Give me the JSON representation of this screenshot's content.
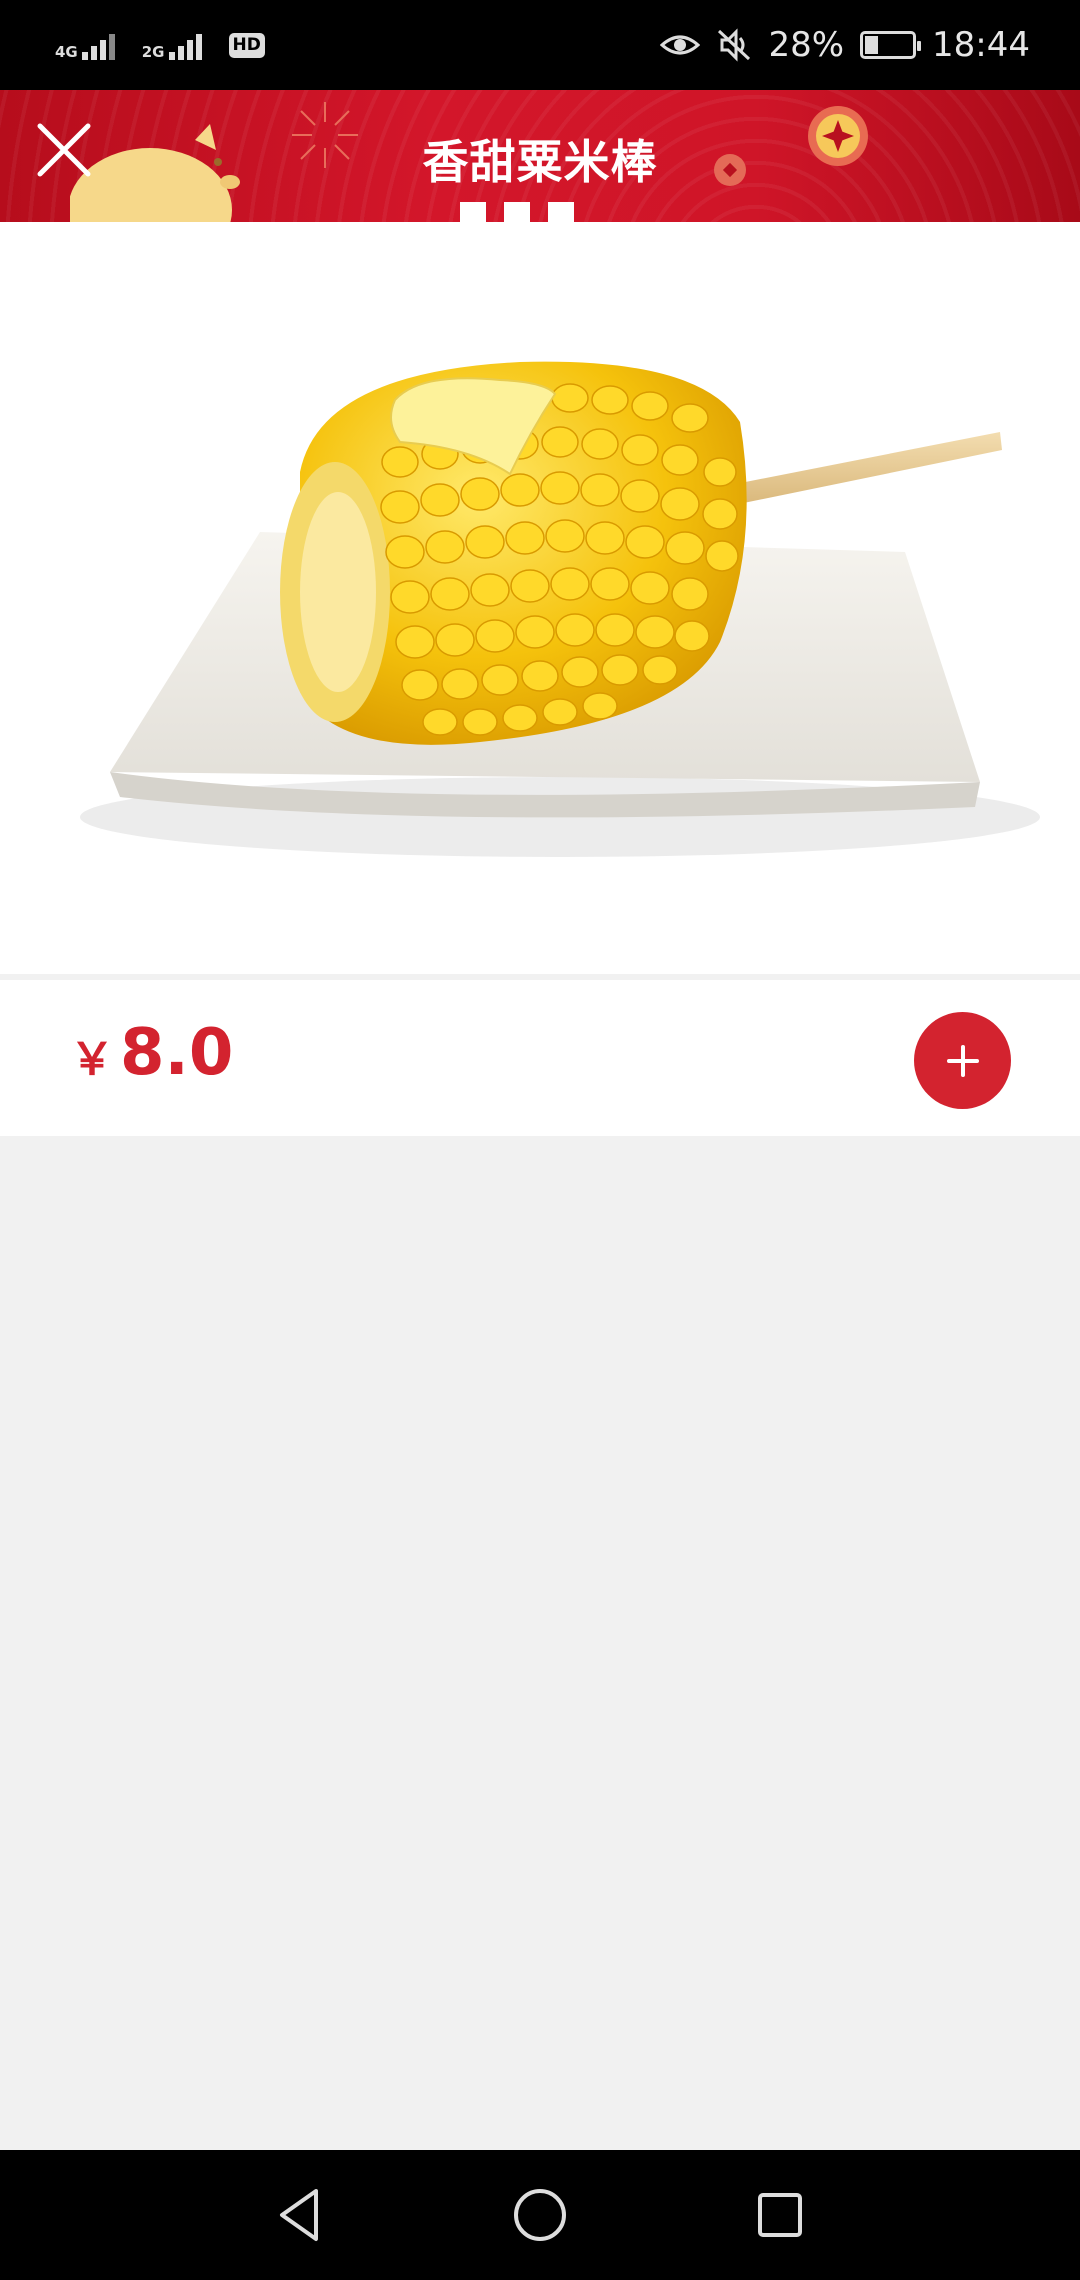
{
  "status_bar": {
    "network_1": "4G",
    "network_2": "2G",
    "hd": "HD",
    "battery_percent": "28%",
    "battery_level": 0.28,
    "time": "18:44",
    "icons": [
      "eye-comfort-icon",
      "mute-icon",
      "battery-icon",
      "signal-icon"
    ]
  },
  "header": {
    "title": "香甜粟米棒",
    "close_icon": "close-icon",
    "bg_color": "#cf1528"
  },
  "product": {
    "image_alt": "corn-on-cob-image",
    "price_symbol": "￥",
    "price_value": "8.0",
    "add_icon": "plus-icon",
    "accent_color": "#d3232f"
  },
  "nav_bar": {
    "buttons": [
      "back-icon",
      "home-icon",
      "recents-icon"
    ]
  }
}
